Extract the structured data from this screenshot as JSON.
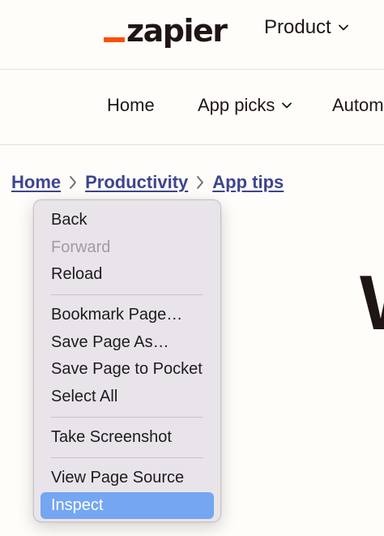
{
  "header": {
    "logo_text": "zapier",
    "logo_color": "#ff4f00",
    "product_label": "Product"
  },
  "sub_nav": {
    "items": [
      "Home",
      "App picks",
      "Autom"
    ]
  },
  "breadcrumb": {
    "items": [
      "Home",
      "Productivity",
      "App tips"
    ]
  },
  "heading_fragment": "W",
  "context_menu": {
    "groups": [
      [
        {
          "label": "Back",
          "enabled": true
        },
        {
          "label": "Forward",
          "enabled": false
        },
        {
          "label": "Reload",
          "enabled": true
        }
      ],
      [
        {
          "label": "Bookmark Page…",
          "enabled": true
        },
        {
          "label": "Save Page As…",
          "enabled": true
        },
        {
          "label": "Save Page to Pocket",
          "enabled": true
        },
        {
          "label": "Select All",
          "enabled": true
        }
      ],
      [
        {
          "label": "Take Screenshot",
          "enabled": true
        }
      ],
      [
        {
          "label": "View Page Source",
          "enabled": true
        },
        {
          "label": "Inspect",
          "enabled": true,
          "highlighted": true
        }
      ]
    ],
    "highlight_color": "#74a6f2"
  }
}
